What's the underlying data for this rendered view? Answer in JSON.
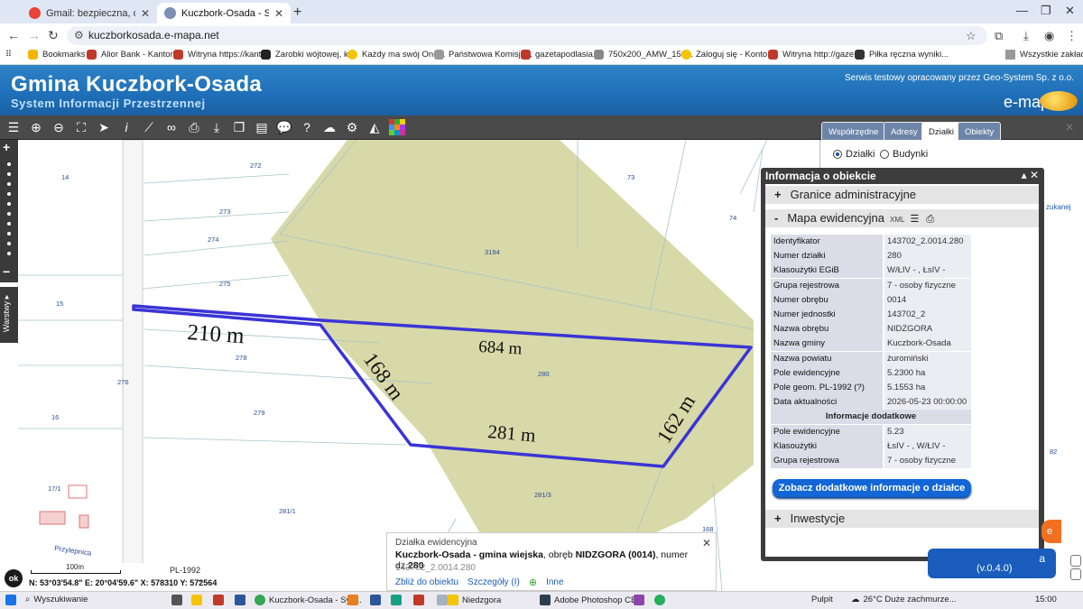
{
  "browser": {
    "tabs": [
      {
        "title": "Gmail: bezpieczna, oparta na AI",
        "active": false
      },
      {
        "title": "Kuczbork-Osada - System Inform",
        "active": true
      }
    ],
    "url": "kuczborkosada.e-mapa.net",
    "bookmarks": [
      "Bookmarks",
      "Alior Bank - Kantor...",
      "Witryna https://kant...",
      "Zarobki wójtowej, kl...",
      "Każdy ma swój One...",
      "Państwowa Komisja...",
      "gazetapodlasia.pl",
      "750x200_AMW_150...",
      "Zaloguj się - Konto...",
      "Witryna http://gaze...",
      "Piłka ręczna wyniki...",
      "Wszystkie zakładki"
    ]
  },
  "site": {
    "title": "Gmina Kuczbork-Osada",
    "subtitle": "System Informacji Przestrzennej",
    "note": "Serwis testowy opracowany przez Geo-System Sp. z o.o.",
    "brand": "e-mapa"
  },
  "right_panel": {
    "tabs": [
      "Współrzędne",
      "Adresy",
      "Działki",
      "Obiekty"
    ],
    "selected_tab": "Działki",
    "radios": [
      "Działki",
      "Budynki"
    ],
    "selected_radio": "Działki",
    "partial": "zukanej"
  },
  "info": {
    "title": "Informacja o obiekcie",
    "sections": [
      "Granice administracyjne",
      "Mapa ewidencyjna",
      "Inwestycje"
    ],
    "xml_label": "XML",
    "rows": [
      {
        "k": "Identyfikator",
        "v": "143702_2.0014.280"
      },
      {
        "k": "Numer działki",
        "v": "280"
      },
      {
        "k": "Klasoużytki EGiB",
        "v": "W/ŁIV - , ŁsIV -"
      },
      {
        "k": "Grupa rejestrowa",
        "v": "7 - osoby fizyczne"
      },
      {
        "k": "Numer obrębu",
        "v": "0014"
      },
      {
        "k": "Numer jednostki",
        "v": "143702_2"
      },
      {
        "k": "Nazwa obrębu",
        "v": "NIDZGORA"
      },
      {
        "k": "Nazwa gminy",
        "v": "Kuczbork-Osada"
      },
      {
        "k": "Nazwa powiatu",
        "v": "żuromiński"
      },
      {
        "k": "Pole ewidencyjne",
        "v": "5.2300 ha"
      },
      {
        "k": "Pole geom. PL-1992 (?)",
        "v": "5.1553 ha"
      },
      {
        "k": "Data aktualności",
        "v": "2026-05-23 00:00:00"
      }
    ],
    "extra_header": "Informacje dodatkowe",
    "extra_rows": [
      {
        "k": "Pole ewidencyjne",
        "v": "5.23"
      },
      {
        "k": "Klasoużytki",
        "v": "ŁsIV - , W/ŁIV -"
      },
      {
        "k": "Grupa rejestrowa",
        "v": "7 - osoby fizyczne"
      }
    ],
    "more_button": "Zobacz dodatkowe informacje o działce"
  },
  "map": {
    "measurements": [
      "210 m",
      "684 m",
      "168 m",
      "281 m",
      "162 m"
    ],
    "parcel_labels": [
      "272",
      "14",
      "273",
      "274",
      "275",
      "15",
      "278",
      "276",
      "279",
      "16",
      "17/1",
      "281/1",
      "281/3",
      "3194",
      "280",
      "73",
      "74",
      "82",
      "168"
    ],
    "street": "Przylepnica"
  },
  "popup": {
    "heading": "Działka ewidencyjna",
    "line_bold": "Kuczbork-Osada - gmina wiejska",
    "line_mid": ", obręb ",
    "line_bold2": "NIDZGORA (0014)",
    "line_end": ", numer dz.",
    "line_bold3": "280",
    "id": "143702_2.0014.280",
    "links": [
      "Zbliż do obiektu",
      "Szczegóły (I)",
      "Inne"
    ]
  },
  "statusbar": {
    "ok": "ok",
    "scale": "100m",
    "crs": "PL-1992",
    "coords": "N: 53°03'54.8\"  E: 20°04'59.6\"  X: 578310     Y: 572564"
  },
  "floating": {
    "version": "(v.0.4.0)"
  },
  "taskbar": {
    "search": "Wyszukiwanie",
    "apps": [
      "Kuczbork-Osada - Sys...",
      "Niedzgora",
      "Adobe Photoshop CE"
    ],
    "tray": [
      "Pulpit",
      "26°C  Duże zachmurze...",
      "15:00"
    ]
  }
}
